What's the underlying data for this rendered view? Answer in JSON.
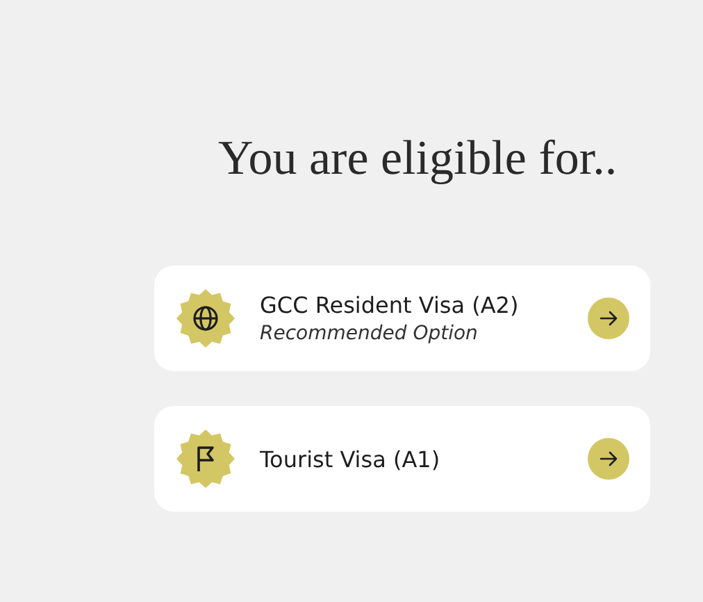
{
  "heading": "You are eligible for..",
  "options": [
    {
      "kind": "globe",
      "title": "GCC Resident Visa (A2)",
      "subtitle": "Recommended Option"
    },
    {
      "kind": "flag",
      "title": "Tourist Visa (A1)"
    }
  ]
}
